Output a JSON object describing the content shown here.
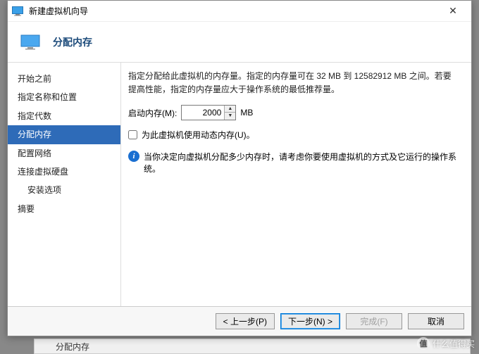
{
  "window": {
    "title": "新建虚拟机向导"
  },
  "header": {
    "title": "分配内存"
  },
  "sidebar": {
    "items": [
      {
        "label": "开始之前",
        "selected": false
      },
      {
        "label": "指定名称和位置",
        "selected": false
      },
      {
        "label": "指定代数",
        "selected": false
      },
      {
        "label": "分配内存",
        "selected": true
      },
      {
        "label": "配置网络",
        "selected": false
      },
      {
        "label": "连接虚拟硬盘",
        "selected": false
      },
      {
        "label": "安装选项",
        "selected": false,
        "sub": true
      },
      {
        "label": "摘要",
        "selected": false
      }
    ]
  },
  "content": {
    "description": "指定分配给此虚拟机的内存量。指定的内存量可在 32 MB 到 12582912 MB 之间。若要提高性能，指定的内存量应大于操作系统的最低推荐量。",
    "memory_label": "启动内存(M):",
    "memory_value": "2000",
    "memory_unit": "MB",
    "dynamic_label": "为此虚拟机使用动态内存(U)。",
    "info_text": "当你决定向虚拟机分配多少内存时，请考虑你要使用虚拟机的方式及它运行的操作系统。"
  },
  "footer": {
    "prev": "< 上一步(P)",
    "next": "下一步(N) >",
    "finish": "完成(F)",
    "cancel": "取消"
  },
  "bg": {
    "label": "分配内存"
  },
  "watermark": {
    "text": "什么值得买"
  }
}
